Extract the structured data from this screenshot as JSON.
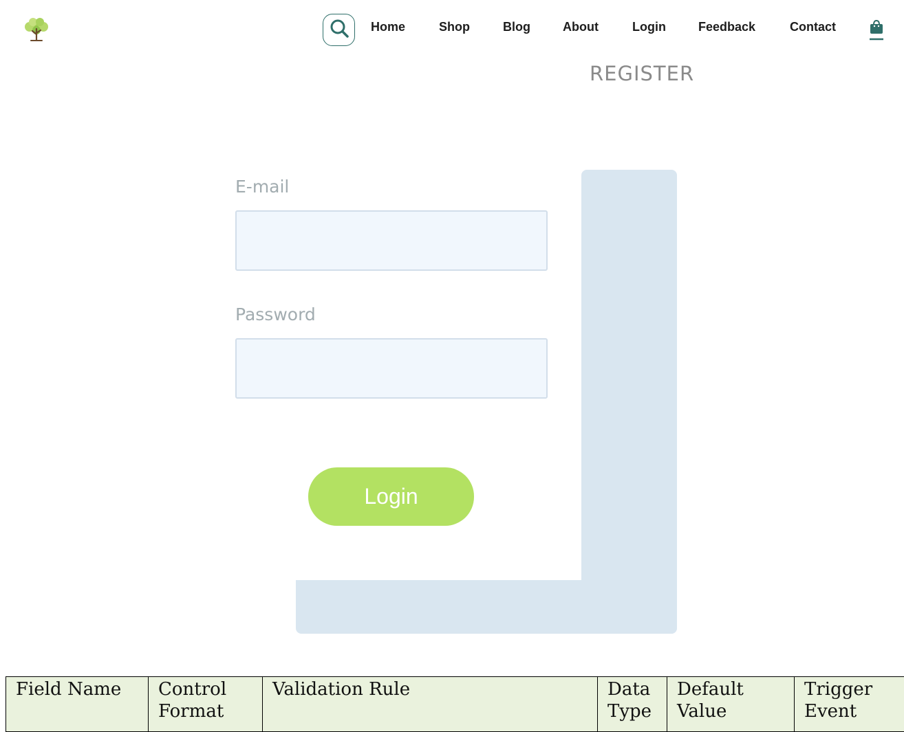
{
  "nav": {
    "items": [
      {
        "label": "Home"
      },
      {
        "label": "Shop"
      },
      {
        "label": "Blog"
      },
      {
        "label": "About"
      },
      {
        "label": "Login"
      },
      {
        "label": "Feedback"
      },
      {
        "label": "Contact"
      }
    ]
  },
  "icons": {
    "logo": "tree-logo-icon",
    "search": "search-icon",
    "cart": "shopping-bag-icon"
  },
  "colors": {
    "accent_teal": "#2f6f6a",
    "button_green": "#b3e162",
    "panel_blue": "#d9e6f0",
    "input_bg": "#f1f7fd",
    "table_bg": "#eaf2dd"
  },
  "page": {
    "title": "REGISTER"
  },
  "form": {
    "email_label": "E-mail",
    "email_value": "",
    "password_label": "Password",
    "password_value": "",
    "submit_label": "Login"
  },
  "spec_table": {
    "headers": [
      "Field Name",
      "Control Format",
      "Validation Rule",
      "Data Type",
      "Default Value",
      "Trigger Event"
    ]
  }
}
